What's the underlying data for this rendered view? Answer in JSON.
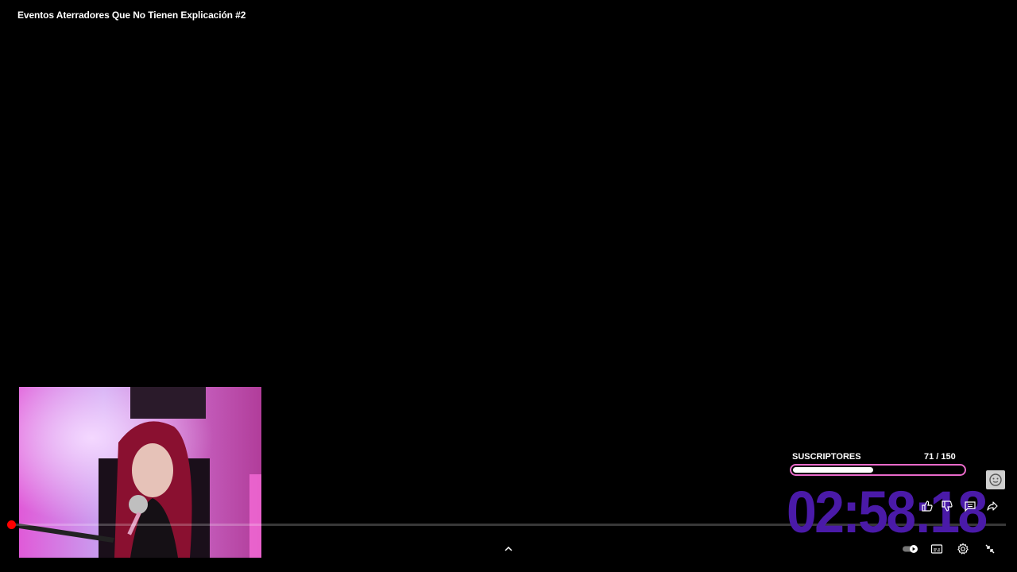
{
  "video": {
    "title": "Eventos Aterradores Que No Tienen Explicación #2"
  },
  "overlay": {
    "subscribers_label": "SUSCRIPTORES",
    "subscribers_count": "71  / 150",
    "subscribers_progress": 0.47,
    "timer": "02:58:18",
    "timer_color": "#4a1aa8",
    "bar_border_color": "#e86ac9"
  },
  "player": {
    "progress_color": "#ff0000",
    "icons": [
      "face-icon",
      "like-icon",
      "dislike-icon",
      "comments-icon",
      "share-icon",
      "chevron-up-icon",
      "autoplay-toggle",
      "captions-icon",
      "settings-icon",
      "exit-fullscreen-icon"
    ]
  }
}
